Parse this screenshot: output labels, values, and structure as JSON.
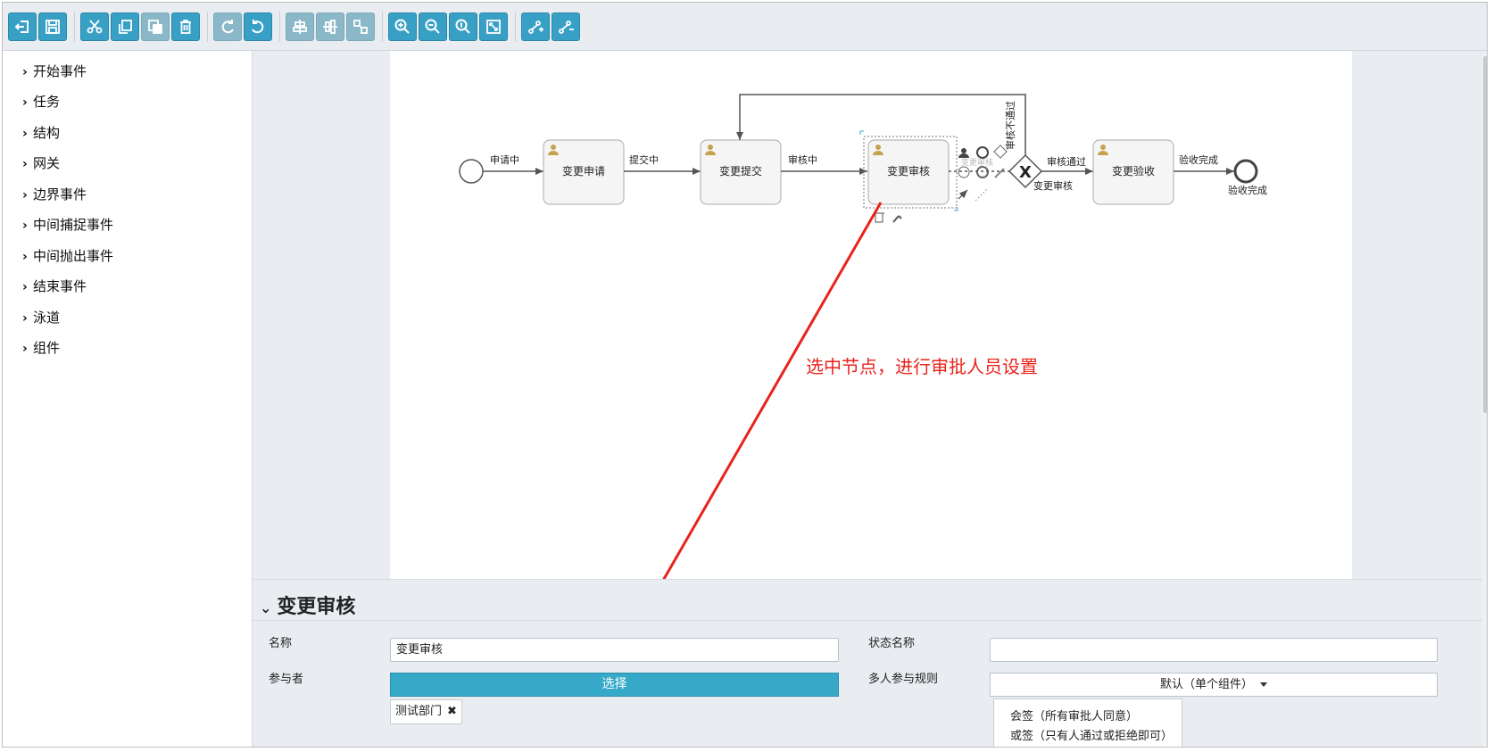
{
  "toolbar": {
    "buttons": [
      {
        "name": "exit-button",
        "icon": "exit-icon"
      },
      {
        "name": "save-button",
        "icon": "save-icon"
      },
      {
        "name": "cut-button",
        "icon": "scissors-icon"
      },
      {
        "name": "copy-button",
        "icon": "copy-icon"
      },
      {
        "name": "paste-button",
        "icon": "paste-icon"
      },
      {
        "name": "delete-button",
        "icon": "trash-icon"
      },
      {
        "name": "redo-button",
        "icon": "redo-icon"
      },
      {
        "name": "undo-button",
        "icon": "undo-icon"
      },
      {
        "name": "align-horizontal-button",
        "icon": "align-horizontal-icon"
      },
      {
        "name": "align-vertical-button",
        "icon": "align-vertical-icon"
      },
      {
        "name": "same-size-button",
        "icon": "same-size-icon"
      },
      {
        "name": "zoom-in-button",
        "icon": "zoom-in-icon"
      },
      {
        "name": "zoom-out-button",
        "icon": "zoom-out-icon"
      },
      {
        "name": "zoom-actual-button",
        "icon": "zoom-actual-icon"
      },
      {
        "name": "zoom-fit-button",
        "icon": "fit-icon"
      },
      {
        "name": "add-bendpoint-button",
        "icon": "add-bendpoint-icon"
      },
      {
        "name": "remove-bendpoint-button",
        "icon": "remove-bendpoint-icon"
      }
    ]
  },
  "sidebar": {
    "items": [
      {
        "label": "开始事件"
      },
      {
        "label": "任务"
      },
      {
        "label": "结构"
      },
      {
        "label": "网关"
      },
      {
        "label": "边界事件"
      },
      {
        "label": "中间捕捉事件"
      },
      {
        "label": "中间抛出事件"
      },
      {
        "label": "结束事件"
      },
      {
        "label": "泳道"
      },
      {
        "label": "组件"
      }
    ]
  },
  "diagram": {
    "tasks": {
      "apply": "变更申请",
      "submit": "变更提交",
      "review": "变更审核",
      "accept": "变更验收"
    },
    "flows": {
      "applying": "申请中",
      "submitting": "提交中",
      "reviewing": "审核中",
      "rejected": "审核不通过",
      "approved": "审核通过",
      "accept_done": "验收完成"
    },
    "gateway_label": "变更审核",
    "end_label": "验收完成",
    "ghost_label": "变更审核"
  },
  "annotation": "选中节点，进行审批人员设置",
  "properties": {
    "title": "变更审核",
    "name_label": "名称",
    "name_value": "变更审核",
    "state_name_label": "状态名称",
    "state_name_value": "",
    "participant_label": "参与者",
    "select_button": "选择",
    "participant_tag": "测试部门",
    "multi_rule_label": "多人参与规则",
    "multi_rule_value": "默认（单个组件）",
    "multi_rule_options": [
      "会签（所有审批人同意）",
      "或签（只有人通过或拒绝即可）"
    ]
  },
  "colors": {
    "accent": "#39a0c5",
    "annotation": "#e8231c"
  }
}
